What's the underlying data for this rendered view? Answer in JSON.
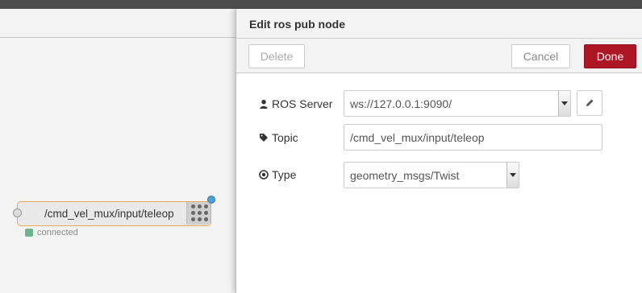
{
  "editor": {
    "title": "Edit ros pub node",
    "delete_label": "Delete",
    "cancel_label": "Cancel",
    "done_label": "Done",
    "fields": {
      "server": {
        "label": "ROS Server",
        "value": "ws://127.0.0.1:9090/",
        "icon": "user-icon"
      },
      "topic": {
        "label": "Topic",
        "value": "/cmd_vel_mux/input/teleop",
        "icon": "tag-icon"
      },
      "type": {
        "label": "Type",
        "value": "geometry_msgs/Twist",
        "icon": "dot-circle-icon"
      }
    }
  },
  "workspace": {
    "node": {
      "label": "/cmd_vel_mux/input/teleop",
      "status": "connected"
    }
  },
  "colors": {
    "done": "#ad1625",
    "node_border": "#e8a85e",
    "status": "#6db58c",
    "changed": "#4ea1d6"
  }
}
